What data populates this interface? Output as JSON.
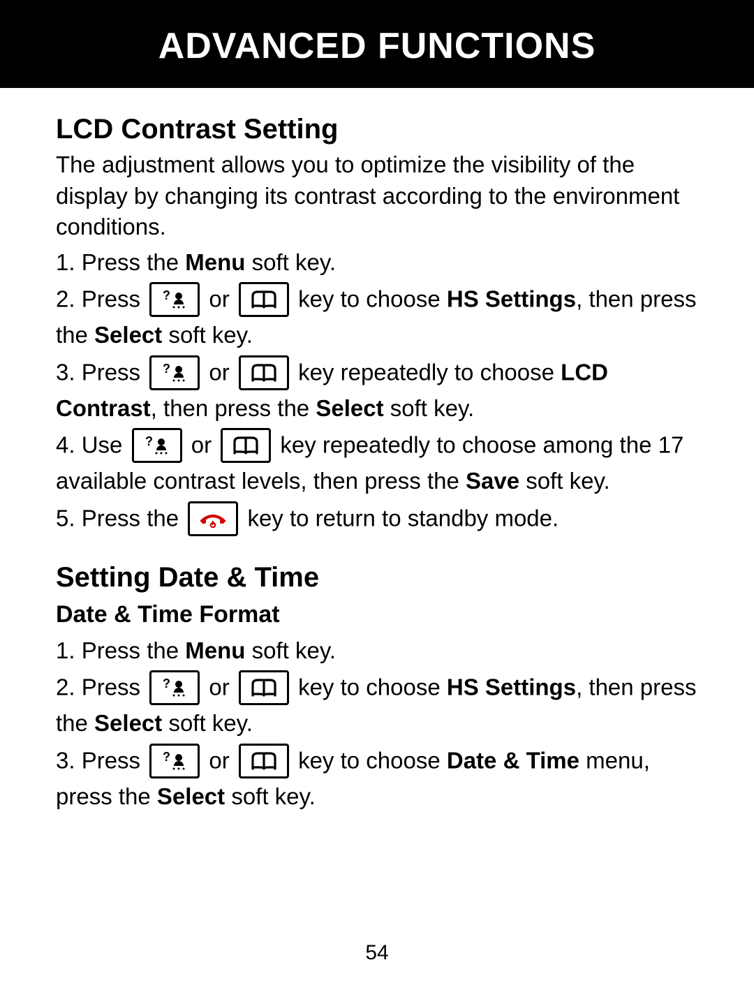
{
  "title": "ADVANCED FUNCTIONS",
  "page_number": "54",
  "section1": {
    "heading": "LCD Contrast Setting",
    "intro": "The adjustment allows you to optimize the visibility of the display by changing its contrast according to the environment conditions.",
    "step1_a": "1. Press the ",
    "step1_b": "Menu",
    "step1_c": " soft key.",
    "step2_a": "2. Press ",
    "step2_b": " or ",
    "step2_c": " key to choose ",
    "step2_d": "HS Settings",
    "step2_e": ", then press the ",
    "step2_f": "Select",
    "step2_g": " soft key.",
    "step3_a": "3. Press ",
    "step3_b": " or ",
    "step3_c": " key repeatedly to choose ",
    "step3_d": "LCD Contrast",
    "step3_e": ", then press the ",
    "step3_f": "Select",
    "step3_g": " soft key.",
    "step4_a": "4. Use ",
    "step4_b": " or ",
    "step4_c": " key repeatedly to choose among the 17 available contrast levels, then press the ",
    "step4_d": "Save",
    "step4_e": " soft key.",
    "step5_a": "5. Press the ",
    "step5_b": " key to return to standby mode."
  },
  "section2": {
    "heading": "Setting Date & Time",
    "subheading": "Date & Time Format",
    "step1_a": "1. Press the ",
    "step1_b": "Menu",
    "step1_c": " soft key.",
    "step2_a": "2. Press ",
    "step2_b": " or ",
    "step2_c": " key to choose ",
    "step2_d": "HS Settings",
    "step2_e": ", then press the ",
    "step2_f": "Select",
    "step2_g": " soft key.",
    "step3_a": "3. Press ",
    "step3_b": " or ",
    "step3_c": " key to choose ",
    "step3_d": "Date & Time",
    "step3_e": " menu, press the ",
    "step3_f": "Select",
    "step3_g": " soft key."
  }
}
